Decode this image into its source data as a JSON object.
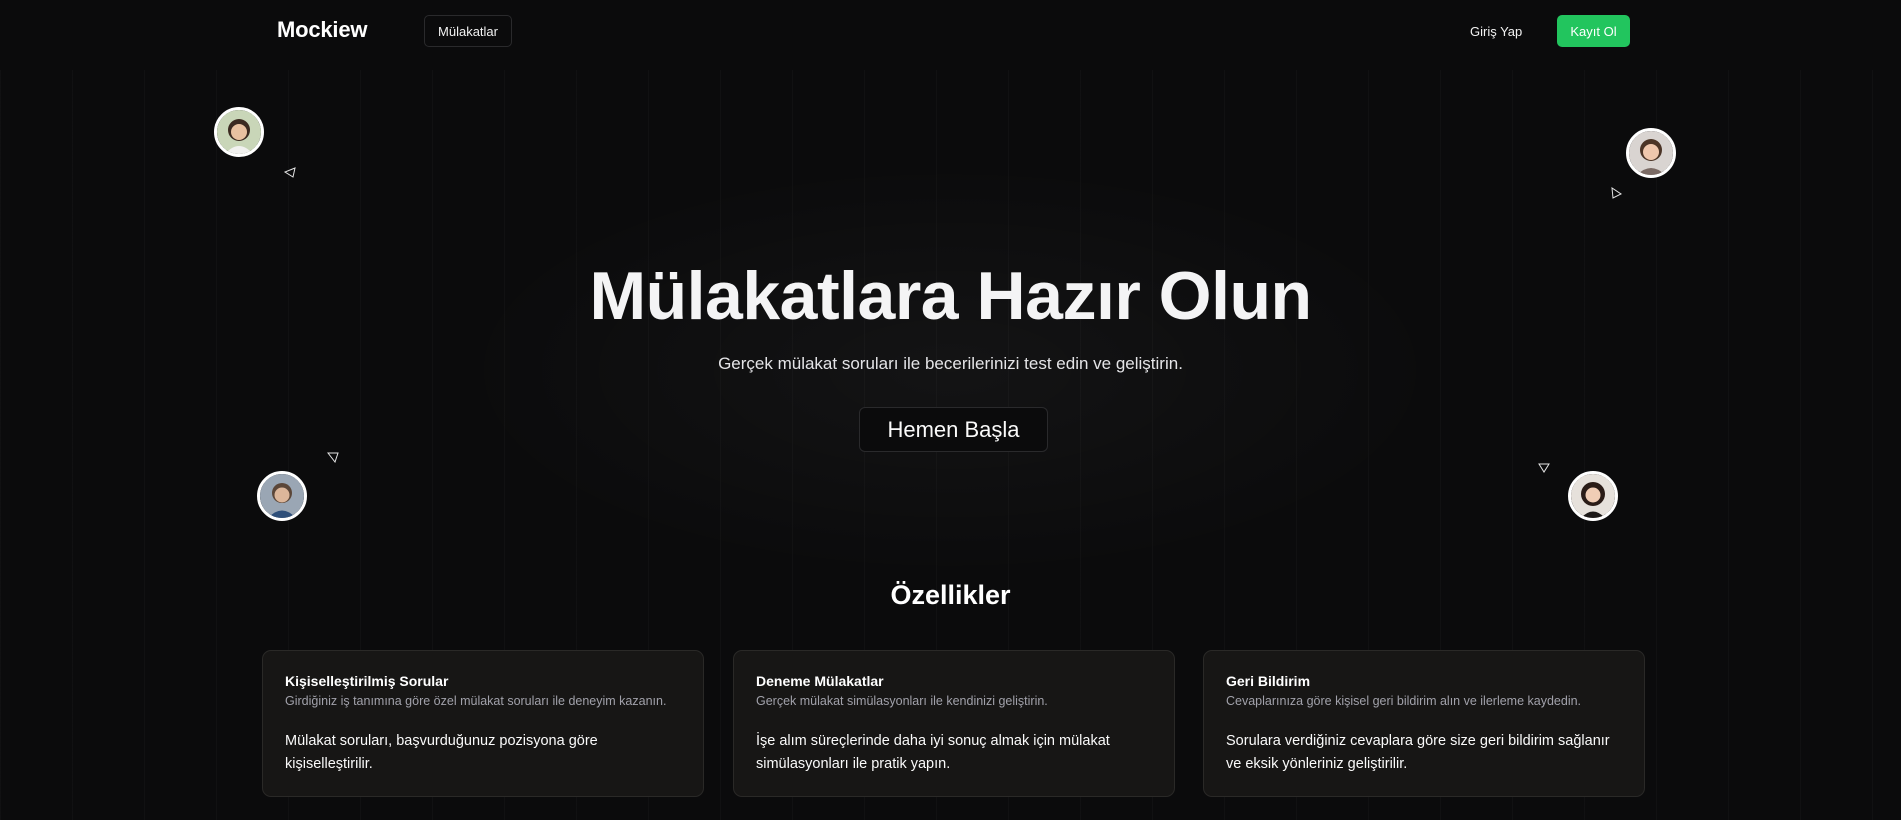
{
  "header": {
    "logo": "Mockiew",
    "nav_interviews": "Mülakatlar",
    "login": "Giriş Yap",
    "signup": "Kayıt Ol"
  },
  "hero": {
    "title": "Mülakatlara Hazır Olun",
    "subtitle": "Gerçek mülakat soruları ile becerilerinizi test edin ve geliştirin.",
    "cta": "Hemen Başla"
  },
  "features": {
    "title": "Özellikler",
    "cards": [
      {
        "title": "Kişiselleştirilmiş Sorular",
        "description": "Girdiğiniz iş tanımına göre özel mülakat soruları ile deneyim kazanın.",
        "body": "Mülakat soruları, başvurduğunuz pozisyona göre kişiselleştirilir."
      },
      {
        "title": "Deneme Mülakatlar",
        "description": "Gerçek mülakat simülasyonları ile kendinizi geliştirin.",
        "body": "İşe alım süreçlerinde daha iyi sonuç almak için mülakat simülasyonları ile pratik yapın."
      },
      {
        "title": "Geri Bildirim",
        "description": "Cevaplarınıza göre kişisel geri bildirim alın ve ilerleme kaydedin.",
        "body": "Sorulara verdiğiniz cevaplara göre size geri bildirim sağlanır ve eksik yönleriniz geliştirilir."
      }
    ]
  },
  "colors": {
    "background": "#0b0b0c",
    "accent": "#22c55e",
    "card_background": "#171615"
  },
  "icons": [
    "avatar-photo",
    "cursor-pointer-icon"
  ]
}
